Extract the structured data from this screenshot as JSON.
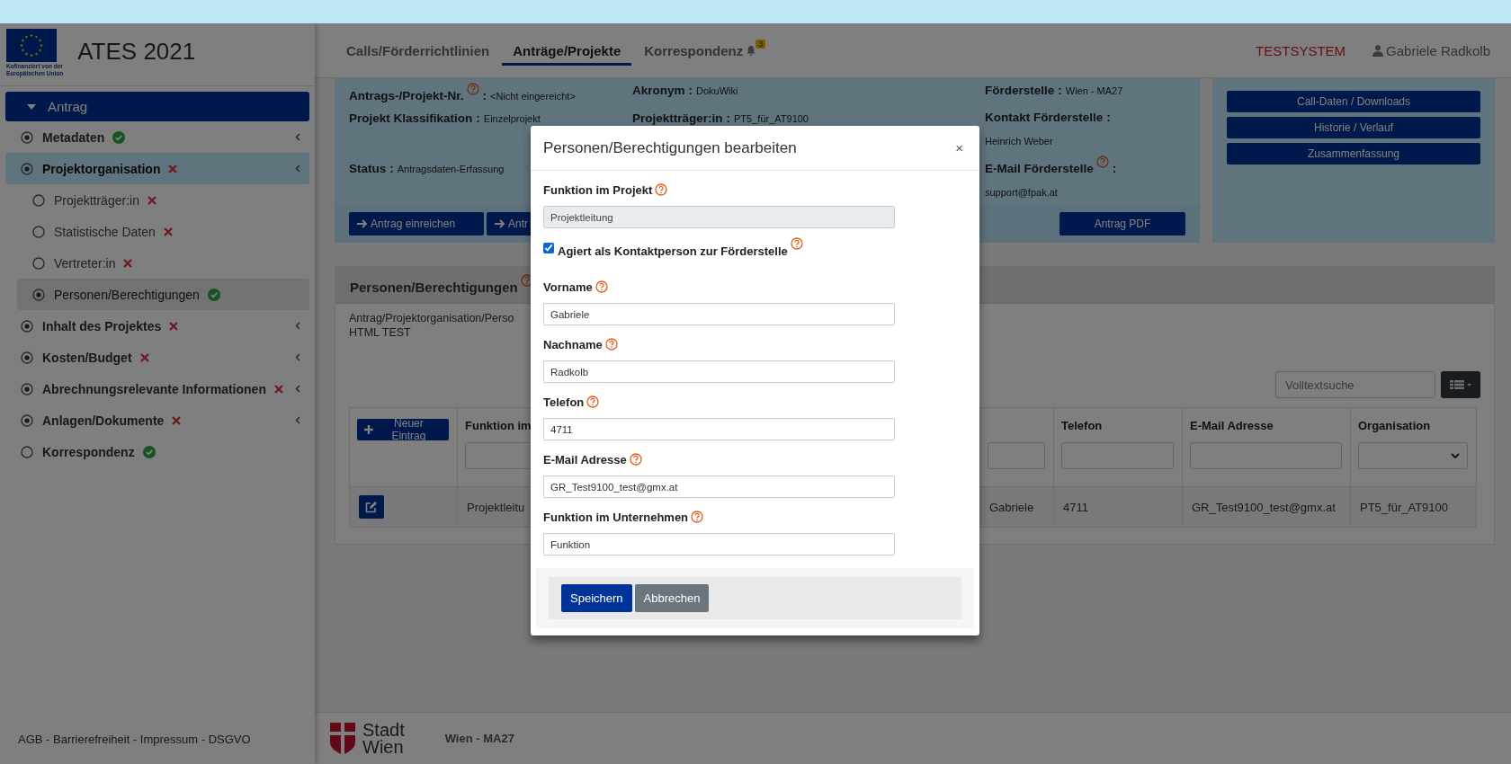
{
  "brand": {
    "eu_caption": [
      "Kofinanziert von der",
      "Europäischen Union"
    ],
    "title": "ATES 2021"
  },
  "sidebar": {
    "items": [
      {
        "label": "Antrag",
        "kind": "group",
        "expanded": true,
        "children": [
          {
            "label": "Metadaten",
            "marked": true,
            "complete": true,
            "submenu": true,
            "selected": false
          },
          {
            "label": "Projektorganisation",
            "marked": true,
            "complete": false,
            "submenu": true,
            "selected": true,
            "children": [
              {
                "label": "Projektträger:in",
                "marked": false,
                "complete": false,
                "selected": false
              },
              {
                "label": "Statistische Daten",
                "marked": false,
                "complete": false,
                "selected": false
              },
              {
                "label": "Vertreter:in",
                "marked": false,
                "complete": false,
                "selected": false
              },
              {
                "label": "Personen/Berechtigungen",
                "marked": true,
                "complete": true,
                "selected": true
              }
            ]
          },
          {
            "label": "Inhalt des Projektes",
            "marked": true,
            "complete": false,
            "submenu": true,
            "selected": false
          },
          {
            "label": "Kosten/Budget",
            "marked": true,
            "complete": false,
            "submenu": true,
            "selected": false
          },
          {
            "label": "Abrechnungsrelevante Informationen",
            "marked": true,
            "complete": false,
            "submenu": true,
            "selected": false
          },
          {
            "label": "Anlagen/Dokumente",
            "marked": true,
            "complete": false,
            "submenu": true,
            "selected": false
          },
          {
            "label": "Korrespondenz",
            "marked": false,
            "complete": true,
            "submenu": false,
            "selected": false
          }
        ]
      }
    ],
    "footer_links": "AGB - Barrierefreiheit - Impressum - DSGVO"
  },
  "top_nav": {
    "tabs": [
      {
        "label": "Calls/Förderrichtlinien",
        "selected": false
      },
      {
        "label": "Anträge/Projekte",
        "selected": true
      },
      {
        "label": "Korrespondenz",
        "selected": false,
        "badge": "3"
      }
    ],
    "environment": "TESTSYSTEM",
    "user": "Gabriele Radkolb"
  },
  "info": {
    "columns": [
      [
        {
          "label": "Antrags-/Projekt-Nr.",
          "help": true,
          "separator": ":",
          "value": "<Nicht eingereicht>"
        },
        {
          "label": "Projekt Klassifikation",
          "help": false,
          "separator": ":",
          "value": "Einzelprojekt"
        },
        {
          "label": "Status",
          "help": false,
          "separator": ":",
          "value": "Antragsdaten-Erfassung"
        }
      ],
      [
        {
          "label": "Akronym",
          "help": false,
          "separator": ":",
          "value": "DokuWiki"
        },
        {
          "label": "Projektträger:in",
          "help": false,
          "separator": ":",
          "value": "PT5_für_AT9100"
        }
      ],
      [
        {
          "label": "Förderstelle",
          "help": false,
          "separator": ":",
          "value": "Wien - MA27"
        },
        {
          "label": "Kontakt Förderstelle",
          "help": false,
          "separator": ":",
          "value": "Heinrich Weber"
        },
        {
          "label": "E-Mail Förderstelle",
          "help": true,
          "separator": ":",
          "value": "support@fpak.at"
        }
      ]
    ],
    "buttons": [
      {
        "label": "Antrag einreichen",
        "arrow": true
      },
      {
        "label": "Antr",
        "arrow": true
      }
    ],
    "pdf_button": "Antrag PDF",
    "side_buttons": [
      "Call-Daten / Downloads",
      "Historie / Verlauf",
      "Zusammenfassung"
    ]
  },
  "section": {
    "title": "Personen/Berechtigungen",
    "help": true,
    "breadcrumb": "Antrag/Projektorganisation/Perso",
    "note": "HTML TEST",
    "search": {
      "placeholder": "Volltextsuche"
    },
    "table": {
      "columns": [
        {
          "kind": "action",
          "button": "Neuer Eintrag"
        },
        {
          "kind": "text",
          "header": "Funktion im"
        },
        {
          "kind": "text"
        },
        {
          "kind": "text",
          "header": "Telefon"
        },
        {
          "kind": "text",
          "header": "E-Mail Adresse"
        },
        {
          "kind": "select",
          "header": "Organisation"
        }
      ],
      "rows": [
        {
          "cells": [
            "",
            "Projektleitu",
            "Gabriele",
            "4711",
            "GR_Test9100_test@gmx.at",
            "PT5_für_AT9100"
          ]
        }
      ]
    }
  },
  "footer": {
    "logo_lines": [
      "Stadt",
      "Wien"
    ],
    "department": "Wien - MA27"
  },
  "modal": {
    "title": "Personen/Berechtigungen bearbeiten",
    "close": "×",
    "fields": [
      {
        "kind": "text",
        "label": "Funktion im Projekt",
        "help": true,
        "value": "Projektleitung",
        "disabled": true
      },
      {
        "kind": "checkbox",
        "label": "Agiert als Kontaktperson zur Förderstelle",
        "help": true,
        "checked": true
      },
      {
        "kind": "text",
        "label": "Vorname",
        "help": true,
        "value": "Gabriele",
        "disabled": false
      },
      {
        "kind": "text",
        "label": "Nachname",
        "help": true,
        "value": "Radkolb",
        "disabled": false
      },
      {
        "kind": "text",
        "label": "Telefon",
        "help": true,
        "value": "4711",
        "disabled": false
      },
      {
        "kind": "text",
        "label": "E-Mail Adresse",
        "help": true,
        "value": "GR_Test9100_test@gmx.at",
        "disabled": false
      },
      {
        "kind": "text",
        "label": "Funktion im Unternehmen",
        "help": true,
        "value": "Funktion",
        "disabled": false
      }
    ],
    "buttons": [
      {
        "label": "Speichern",
        "kind": "primary"
      },
      {
        "label": "Abbrechen",
        "kind": "secondary"
      }
    ]
  }
}
